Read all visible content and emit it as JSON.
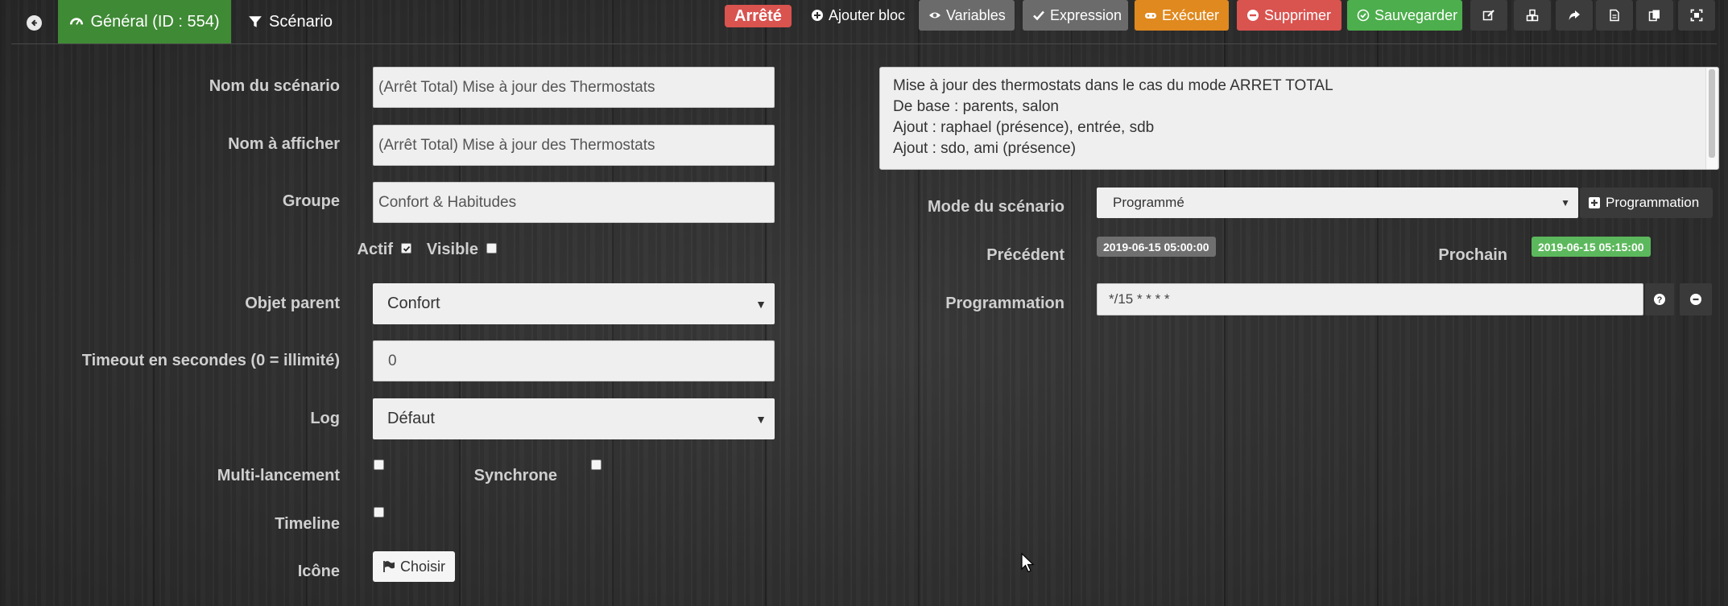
{
  "header": {
    "tab_general": "Général (ID : 554)",
    "tab_scenario": "Scénario",
    "status": "Arrêté"
  },
  "toolbar": {
    "add_block": "Ajouter bloc",
    "variables": "Variables",
    "expression": "Expression",
    "execute": "Exécuter",
    "delete": "Supprimer",
    "save": "Sauvegarder"
  },
  "form": {
    "name_label": "Nom du scénario",
    "name_value": "(Arrêt Total) Mise à jour des Thermostats",
    "display_label": "Nom à afficher",
    "display_value": "(Arrêt Total) Mise à jour des Thermostats",
    "group_label": "Groupe",
    "group_value": "Confort & Habitudes",
    "active_label": "Actif",
    "active_checked": true,
    "visible_label": "Visible",
    "visible_checked": false,
    "parent_label": "Objet parent",
    "parent_value": "Confort",
    "timeout_label": "Timeout en secondes (0 = illimité)",
    "timeout_value": "0",
    "log_label": "Log",
    "log_value": "Défaut",
    "multi_label": "Multi-lancement",
    "sync_label": "Synchrone",
    "timeline_label": "Timeline",
    "icon_label": "Icône",
    "icon_button": "Choisir"
  },
  "description": {
    "lines": [
      "Mise à jour des thermostats dans le cas du mode ARRET TOTAL",
      "De base : parents, salon",
      "Ajout : raphael (présence), entrée, sdb",
      "Ajout : sdo, ami (présence)"
    ]
  },
  "schedule": {
    "mode_label": "Mode du scénario",
    "mode_value": "Programmé",
    "programmation_button": "Programmation",
    "previous_label": "Précédent",
    "previous_value": "2019-06-15 05:00:00",
    "next_label": "Prochain",
    "next_value": "2019-06-15 05:15:00",
    "cron_label": "Programmation",
    "cron_value": "*/15 * * * *"
  },
  "colors": {
    "general_tab": "#3f8a35",
    "status_red": "#d9534f",
    "execute_orange": "#e0891e",
    "save_green": "#4cae4c",
    "next_badge": "#5cb85c",
    "prev_badge": "#6f6f6f"
  }
}
